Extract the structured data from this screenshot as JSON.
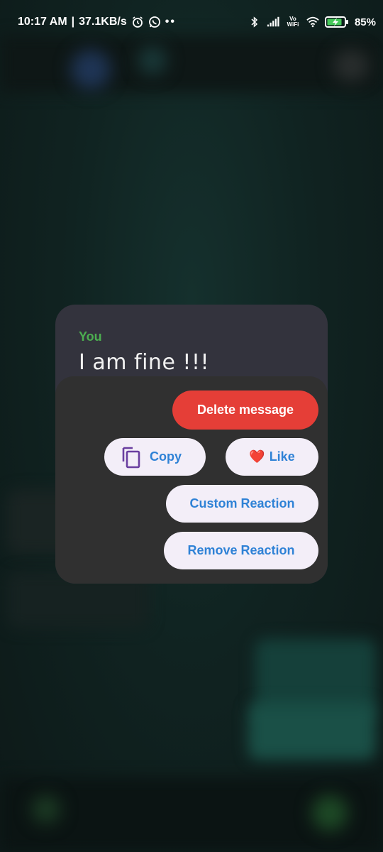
{
  "status_bar": {
    "time": "10:17 AM",
    "speed": "37.1KB/s",
    "separator": "|",
    "dots": "••",
    "battery": "85%",
    "network_label": "Vo WiFi",
    "icons": [
      "alarm-icon",
      "whatsapp-icon",
      "bluetooth-icon",
      "signal-icon",
      "vowifi-icon",
      "wifi-icon",
      "battery-icon"
    ]
  },
  "message": {
    "sender": "You",
    "text": "I am fine !!!"
  },
  "menu": {
    "delete_label": "Delete message",
    "copy_label": "Copy",
    "like_label": "Like",
    "like_emoji": "❤️",
    "custom_reaction_label": "Custom Reaction",
    "remove_reaction_label": "Remove Reaction"
  },
  "colors": {
    "sender": "#4caf50",
    "delete_bg": "#e53e37",
    "pill_bg": "#f3eef8",
    "pill_text": "#2f82d6",
    "copy_icon": "#6a3fa0",
    "card_bg": "#33333d",
    "panel_bg": "#303030"
  }
}
